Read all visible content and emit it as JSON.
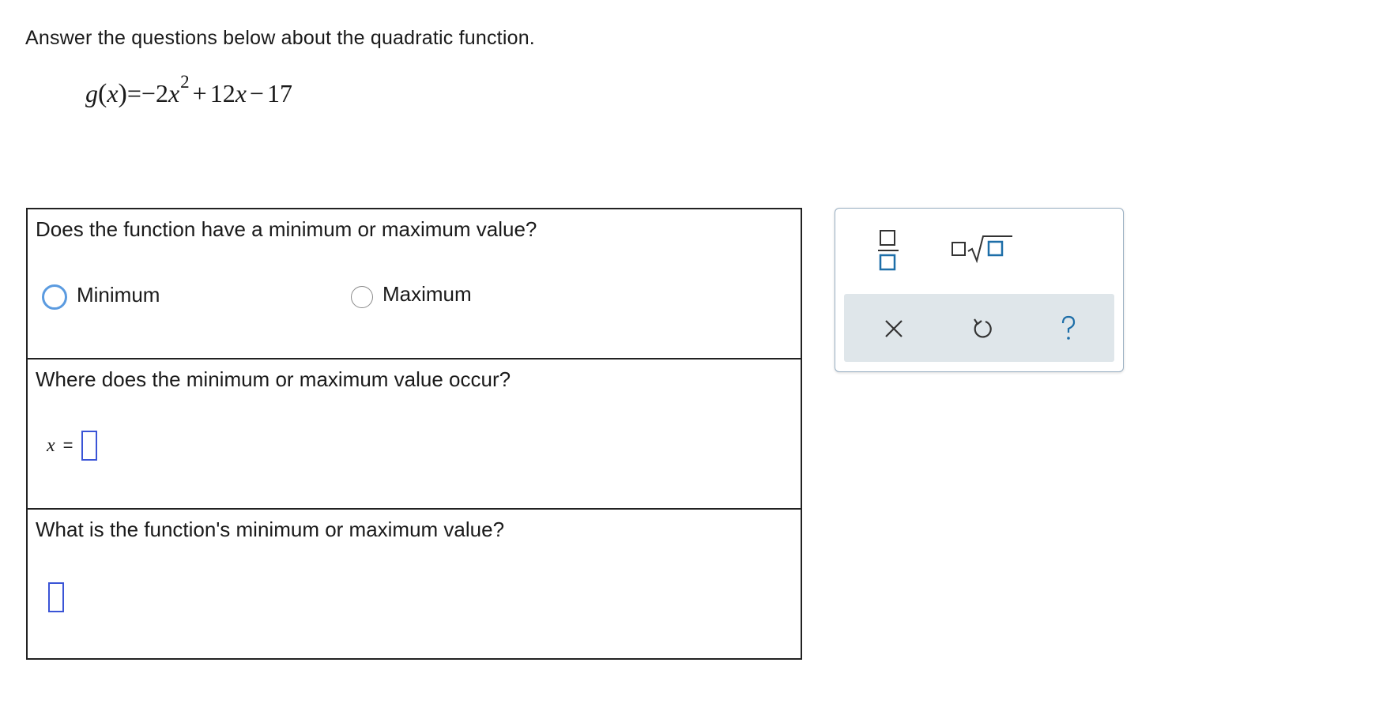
{
  "instruction": "Answer the questions below about the quadratic function.",
  "function": {
    "name": "g",
    "variable": "x",
    "equals": "=",
    "lead_sign": "−",
    "a": "2",
    "exponent": "2",
    "op1": "+",
    "b": "12",
    "op2": "−",
    "c": "17"
  },
  "questions": [
    {
      "text": "Does the function have a minimum or maximum value?",
      "options": [
        "Minimum",
        "Maximum"
      ],
      "selected": null
    },
    {
      "text": "Where does the minimum or maximum value occur?",
      "answer_label": "x",
      "answer_eq": "=",
      "answer_value": ""
    },
    {
      "text": "What is the function's minimum or maximum value?",
      "answer_value": ""
    }
  ],
  "toolbox": {
    "tools": [
      "fraction-icon",
      "sqrt-icon"
    ],
    "actions": [
      "close-icon",
      "undo-icon",
      "help-icon"
    ],
    "border_color": "#9ab0c3",
    "action_bar_color": "#dfe6ea",
    "icon_color": "#1d6ea8",
    "input_border_color": "#3a54d6",
    "focus_radio_color": "#5b9be0"
  }
}
